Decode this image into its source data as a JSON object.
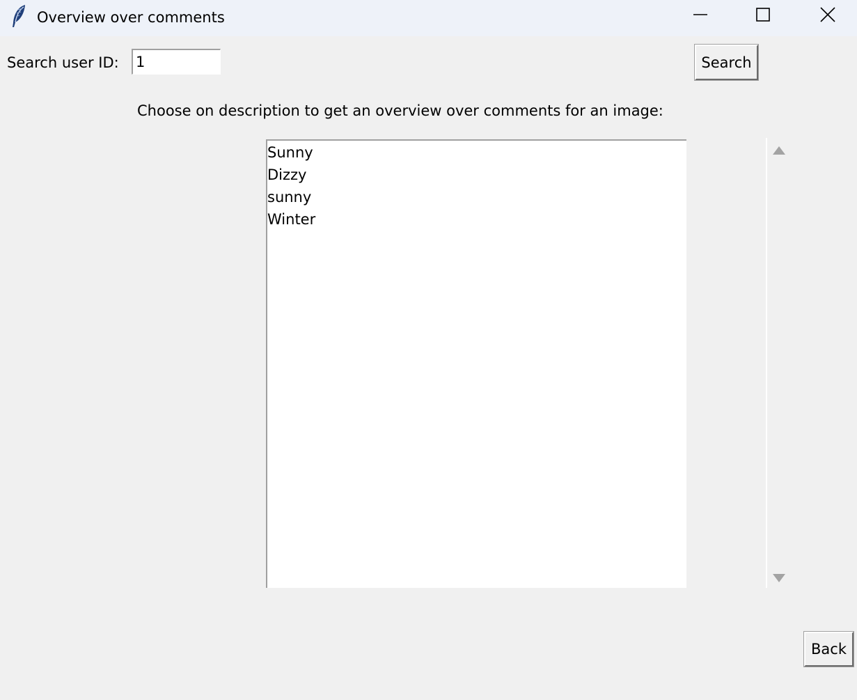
{
  "window": {
    "title": "Overview over comments",
    "app_icon": "feather-icon",
    "controls": {
      "minimize_icon": "minimize-icon",
      "maximize_icon": "maximize-icon",
      "close_icon": "close-icon"
    }
  },
  "search": {
    "label": "Search user ID:",
    "value": "1",
    "button_label": "Search"
  },
  "instruction": "Choose on description to get an overview over comments for an image:",
  "descriptions": {
    "items": [
      "Sunny",
      "Dizzy",
      "sunny",
      "Winter"
    ]
  },
  "scrollbar": {
    "up_icon": "scroll-up-arrow-icon",
    "down_icon": "scroll-down-arrow-icon"
  },
  "footer": {
    "back_label": "Back"
  }
}
